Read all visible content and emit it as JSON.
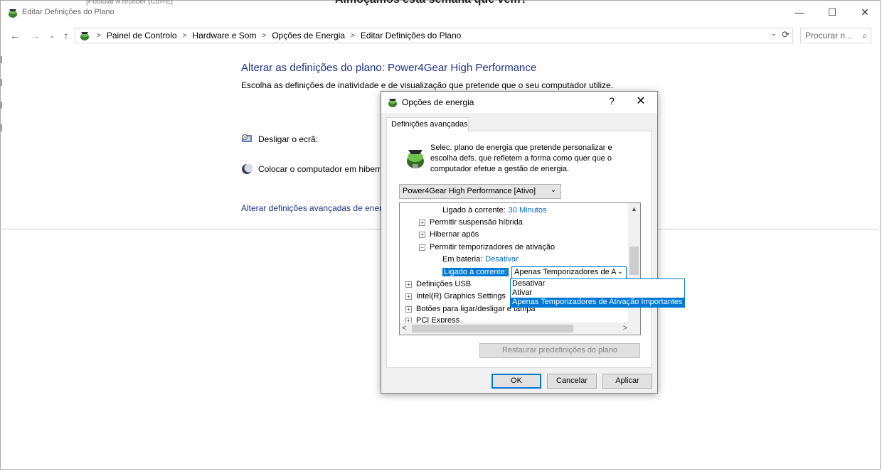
{
  "window": {
    "title": "Editar Definições do Plano",
    "behind_text_1": "[Postular A receber (Ctrl+E)",
    "behind_text_2": "Almoçamos esta semana que vem?",
    "min_glyph": "—",
    "max_glyph": "☐",
    "close_glyph": "✕"
  },
  "nav": {
    "back": "←",
    "forward": "→",
    "recent": "⌄",
    "up": "↑",
    "breadcrumbs": [
      "Painel de Controlo",
      "Hardware e Som",
      "Opções de Energia",
      "Editar Definições do Plano"
    ],
    "sep": ">",
    "dropdown": "⌄",
    "refresh": "⟳",
    "search_placeholder": "Procurar n...",
    "search_glyph": "⌕"
  },
  "content": {
    "title": "Alterar as definições do plano: Power4Gear High Performance",
    "description": "Escolha as definições de inatividade e de visualização que pretende que o seu computador utilize.",
    "display_label": "Desligar o ecrã:",
    "sleep_label": "Colocar o computador em hiberna",
    "advanced_link": "Alterar definições avançadas de energia"
  },
  "dialog": {
    "title": "Opções de energia",
    "help": "?",
    "close": "✕",
    "tab": "Definições avançadas",
    "intro": "Selec. plano de energia que pretende personalizar e escolha defs. que refletem a forma como quer que o computador efetue a gestão de energia.",
    "plan_select": "Power4Gear High Performance [Ativo]",
    "arrow": "⌄",
    "tree": {
      "ac_label": "Ligado à corrente:",
      "ac_value": "30 Minutos",
      "hybrid": "Permitir suspensão híbrida",
      "hibernate": "Hibernar após",
      "wake_timers": "Permitir temporizadores de ativação",
      "battery_label": "Em bateria:",
      "battery_value": "Desativar",
      "ac_selected_label": "Ligado à corrente:",
      "ac_selected_value": "Apenas Temporizadores de A",
      "usb": "Definições USB",
      "intel": "Intel(R) Graphics Settings",
      "buttons": "Botões para ligar/desligar e tampa",
      "pci": "PCI Express",
      "plus": "+",
      "minus": "−"
    },
    "scroll": {
      "up": "▲",
      "left": "<",
      "right": ">"
    },
    "dropdown_options": [
      "Desativar",
      "Ativar",
      "Apenas Temporizadores de Ativação Importantes"
    ],
    "restore": "Restaurar predefinições do plano",
    "ok": "OK",
    "cancel": "Cancelar",
    "apply": "Aplicar"
  },
  "colors": {
    "link_blue": "#1e3287",
    "selection_blue": "#0078d7",
    "value_blue": "#0066cc"
  },
  "icons": [
    "power-plan-icon",
    "monitor-icon",
    "moon-icon",
    "search-icon",
    "refresh-icon"
  ]
}
